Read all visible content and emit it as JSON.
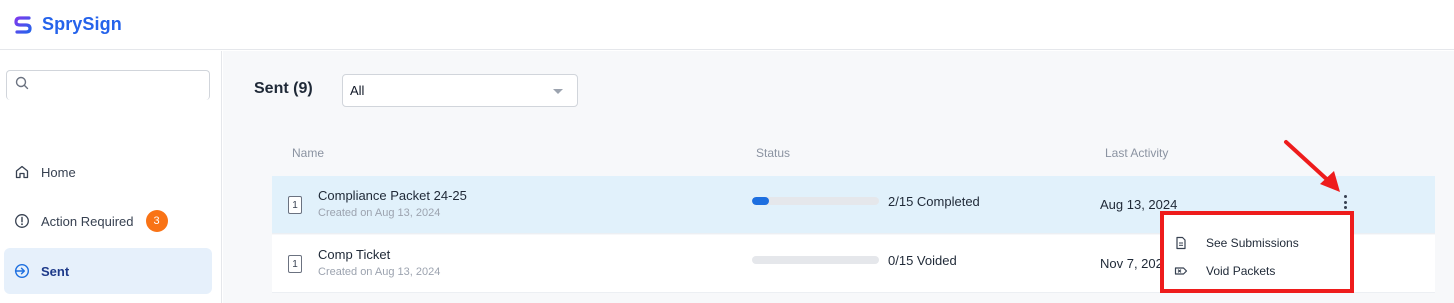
{
  "app": {
    "brand": "SprySign",
    "brand_color": "#2563eb"
  },
  "search": {
    "placeholder": "",
    "value": ""
  },
  "sidebar": {
    "items": [
      {
        "label": "Home",
        "icon": "home-icon"
      },
      {
        "label": "Action Required",
        "icon": "alert-circle-icon",
        "badge": "3"
      },
      {
        "label": "Sent",
        "icon": "sent-icon",
        "active": true
      }
    ]
  },
  "main": {
    "title": "Sent (9)",
    "filter": {
      "selected": "All"
    },
    "columns": [
      "Name",
      "Status",
      "Last Activity"
    ],
    "rows": [
      {
        "icon_label": "1",
        "name": "Compliance Packet 24-25",
        "created": "Created on Aug 13, 2024",
        "progress": 0.1333,
        "status": "2/15 Completed",
        "last_activity": "Aug 13, 2024"
      },
      {
        "icon_label": "1",
        "name": "Comp Ticket",
        "created": "Created on Aug 13, 2024",
        "progress": 0,
        "status": "0/15 Voided",
        "last_activity": "Nov 7, 2024"
      }
    ]
  },
  "context_menu": {
    "items": [
      {
        "label": "See Submissions",
        "icon": "document-icon"
      },
      {
        "label": "Void Packets",
        "icon": "void-icon"
      }
    ],
    "highlight_color": "#ee1c1c"
  }
}
